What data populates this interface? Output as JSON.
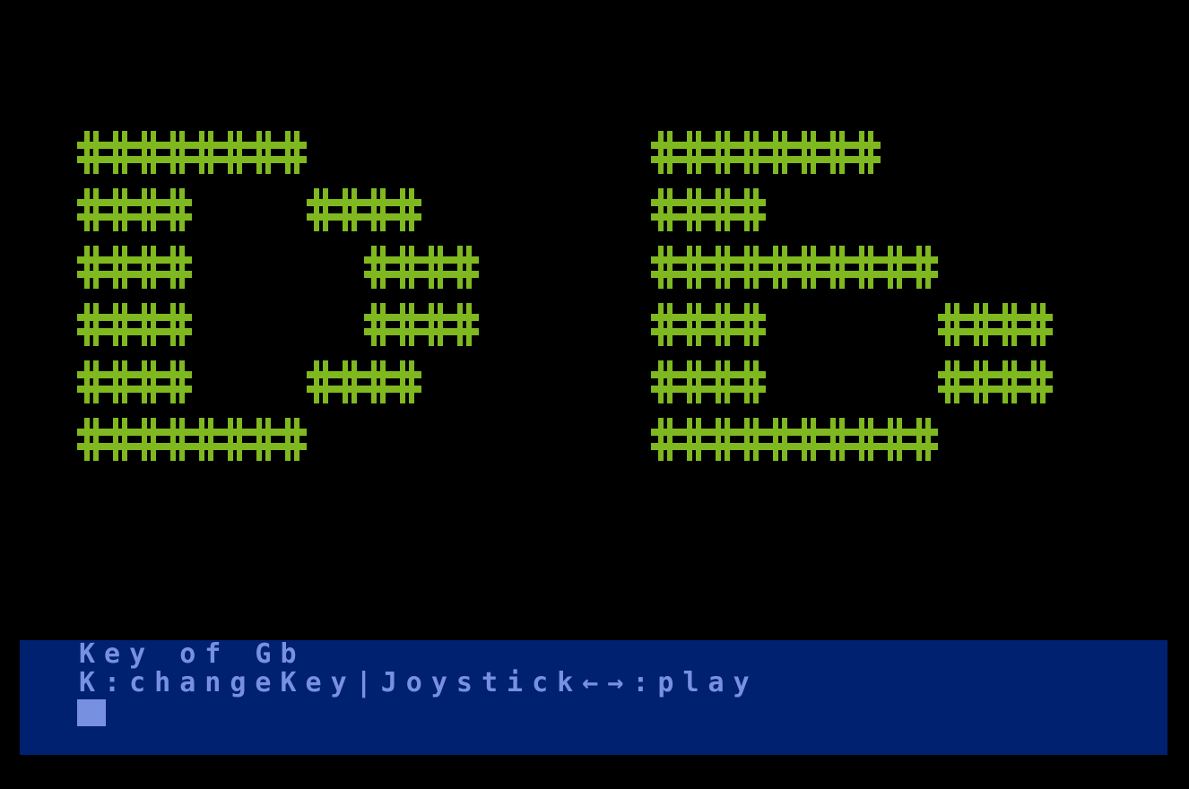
{
  "screen": {
    "background": "#000000",
    "text_window_background": "#002070",
    "text_color": "#7890e0",
    "art_color": "#80b820"
  },
  "big_display": {
    "text": "Db",
    "icon": "hash-block-icon",
    "rows": [
      "####      ####",
      "##  ##    ##",
      "##   ##   #####",
      "##   ##   ##   ##",
      "##  ##    ##   ##",
      "####      #####"
    ]
  },
  "text_window": {
    "status": "Key of Gb",
    "help": "K:changeKey|Joystick←→:play"
  }
}
